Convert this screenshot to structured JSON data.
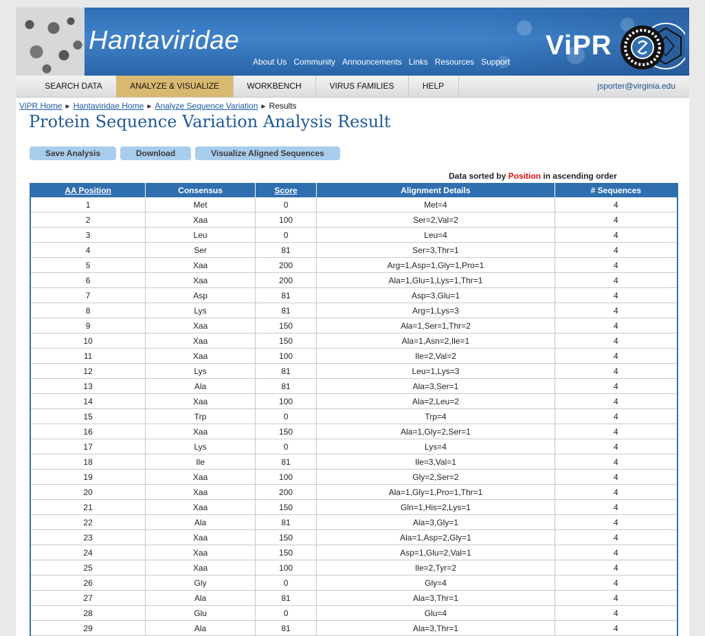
{
  "site": {
    "title": "Hantaviridae",
    "logo_text": "ViPR"
  },
  "top_links": [
    "About Us",
    "Community",
    "Announcements",
    "Links",
    "Resources",
    "Support"
  ],
  "nav": {
    "items": [
      "SEARCH DATA",
      "ANALYZE & VISUALIZE",
      "WORKBENCH",
      "VIRUS FAMILIES",
      "HELP"
    ],
    "active": "ANALYZE & VISUALIZE",
    "user": "jsporter@virginia.edu"
  },
  "breadcrumb": [
    "ViPR Home",
    "Hantaviridae Home",
    "Analyze Sequence Variation",
    "Results"
  ],
  "page_title": "Protein Sequence Variation Analysis Result",
  "buttons": {
    "save": "Save Analysis",
    "download": "Download",
    "visualize": "Visualize Aligned Sequences"
  },
  "sort_note": {
    "prefix": "Data sorted by",
    "field": "Position",
    "suffix": "in ascending order"
  },
  "table": {
    "headers": [
      "AA Position",
      "Consensus",
      "Score",
      "Alignment Details",
      "# Sequences"
    ],
    "rows": [
      [
        "1",
        "Met",
        "0",
        "Met=4",
        "4"
      ],
      [
        "2",
        "Xaa",
        "100",
        "Ser=2,Val=2",
        "4"
      ],
      [
        "3",
        "Leu",
        "0",
        "Leu=4",
        "4"
      ],
      [
        "4",
        "Ser",
        "81",
        "Ser=3,Thr=1",
        "4"
      ],
      [
        "5",
        "Xaa",
        "200",
        "Arg=1,Asp=1,Gly=1,Pro=1",
        "4"
      ],
      [
        "6",
        "Xaa",
        "200",
        "Ala=1,Glu=1,Lys=1,Thr=1",
        "4"
      ],
      [
        "7",
        "Asp",
        "81",
        "Asp=3,Glu=1",
        "4"
      ],
      [
        "8",
        "Lys",
        "81",
        "Arg=1,Lys=3",
        "4"
      ],
      [
        "9",
        "Xaa",
        "150",
        "Ala=1,Ser=1,Thr=2",
        "4"
      ],
      [
        "10",
        "Xaa",
        "150",
        "Ala=1,Asn=2,Ile=1",
        "4"
      ],
      [
        "11",
        "Xaa",
        "100",
        "Ile=2,Val=2",
        "4"
      ],
      [
        "12",
        "Lys",
        "81",
        "Leu=1,Lys=3",
        "4"
      ],
      [
        "13",
        "Ala",
        "81",
        "Ala=3,Ser=1",
        "4"
      ],
      [
        "14",
        "Xaa",
        "100",
        "Ala=2,Leu=2",
        "4"
      ],
      [
        "15",
        "Trp",
        "0",
        "Trp=4",
        "4"
      ],
      [
        "16",
        "Xaa",
        "150",
        "Ala=1,Gly=2,Ser=1",
        "4"
      ],
      [
        "17",
        "Lys",
        "0",
        "Lys=4",
        "4"
      ],
      [
        "18",
        "Ile",
        "81",
        "Ile=3,Val=1",
        "4"
      ],
      [
        "19",
        "Xaa",
        "100",
        "Gly=2,Ser=2",
        "4"
      ],
      [
        "20",
        "Xaa",
        "200",
        "Ala=1,Gly=1,Pro=1,Thr=1",
        "4"
      ],
      [
        "21",
        "Xaa",
        "150",
        "Gln=1,His=2,Lys=1",
        "4"
      ],
      [
        "22",
        "Ala",
        "81",
        "Ala=3,Gly=1",
        "4"
      ],
      [
        "23",
        "Xaa",
        "150",
        "Ala=1,Asp=2,Gly=1",
        "4"
      ],
      [
        "24",
        "Xaa",
        "150",
        "Asp=1,Glu=2,Val=1",
        "4"
      ],
      [
        "25",
        "Xaa",
        "100",
        "Ile=2,Tyr=2",
        "4"
      ],
      [
        "26",
        "Gly",
        "0",
        "Gly=4",
        "4"
      ],
      [
        "27",
        "Ala",
        "81",
        "Ala=3,Thr=1",
        "4"
      ],
      [
        "28",
        "Glu",
        "0",
        "Glu=4",
        "4"
      ],
      [
        "29",
        "Ala",
        "81",
        "Ala=3,Thr=1",
        "4"
      ]
    ]
  },
  "colors": {
    "header_blue": "#2f6fb0",
    "active_tab": "#d9b86f",
    "title_blue": "#1f5896",
    "highlight_red": "#d11010"
  }
}
